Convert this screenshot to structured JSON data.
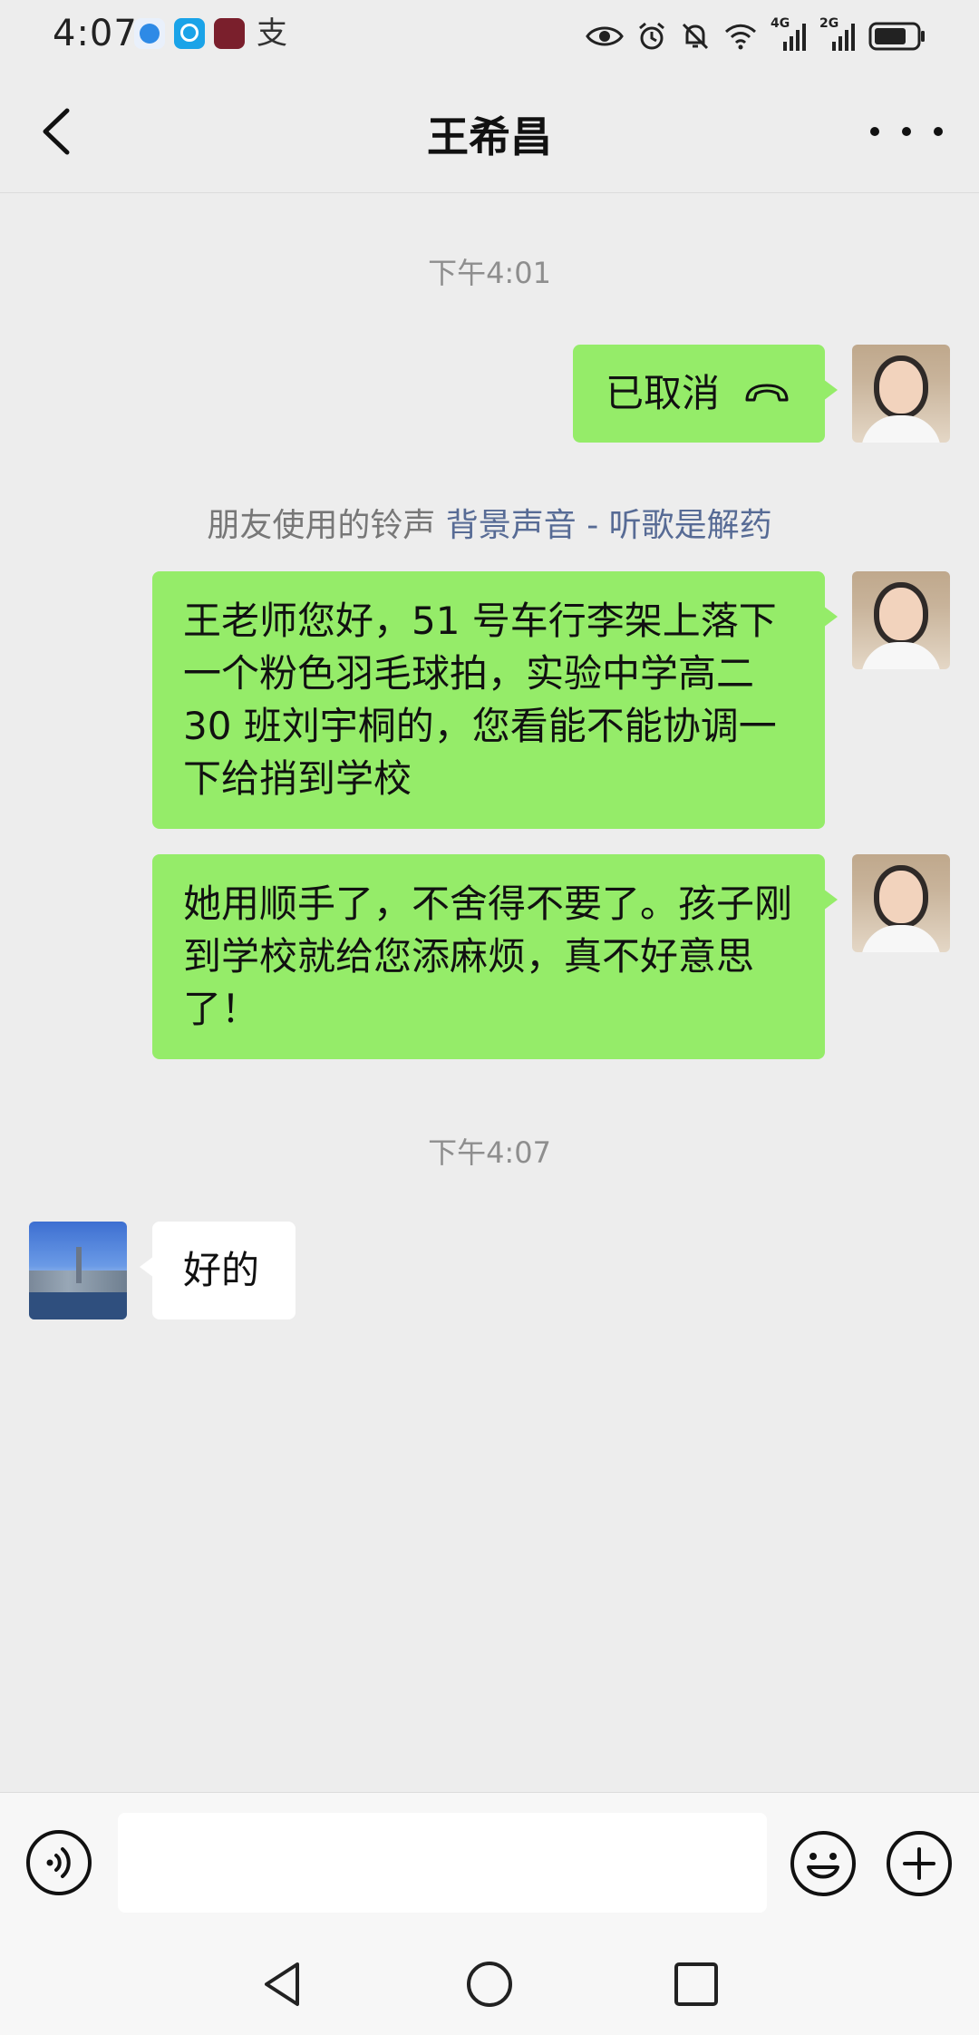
{
  "status_bar": {
    "time": "4:07",
    "char_icon": "支",
    "net1": "4G",
    "net2": "2G",
    "icons": [
      "eye-icon",
      "alarm-icon",
      "mute-icon",
      "wifi-icon",
      "signal-icon",
      "battery-icon"
    ]
  },
  "header": {
    "title": "王希昌",
    "back_icon": "chevron-left-icon",
    "more_icon": "more-icon"
  },
  "chat": {
    "timestamp1": "下午4:01",
    "call": {
      "label": "已取消",
      "icon": "hangup-icon"
    },
    "system_notice": {
      "prefix": "朋友使用的铃声",
      "link": "背景声音 - 听歌是解药"
    },
    "messages": [
      {
        "side": "me",
        "text": "王老师您好，51 号车行李架上落下一个粉色羽毛球拍，实验中学高二30 班刘宇桐的，您看能不能协调一下给捎到学校"
      },
      {
        "side": "me",
        "text": "她用顺手了，不舍得不要了。孩子刚到学校就给您添麻烦，真不好意思了！"
      }
    ],
    "timestamp2": "下午4:07",
    "reply": {
      "side": "other",
      "text": "好的"
    }
  },
  "input_bar": {
    "voice_icon": "voice-icon",
    "input_placeholder": "",
    "emoji_icon": "emoji-icon",
    "plus_icon": "plus-icon"
  },
  "system_nav": {
    "icons": [
      "nav-back-icon",
      "nav-home-icon",
      "nav-recent-icon"
    ]
  },
  "colors": {
    "background": "#ededed",
    "my_bubble": "#95ec69",
    "other_bubble": "#ffffff",
    "link": "#576b95"
  }
}
